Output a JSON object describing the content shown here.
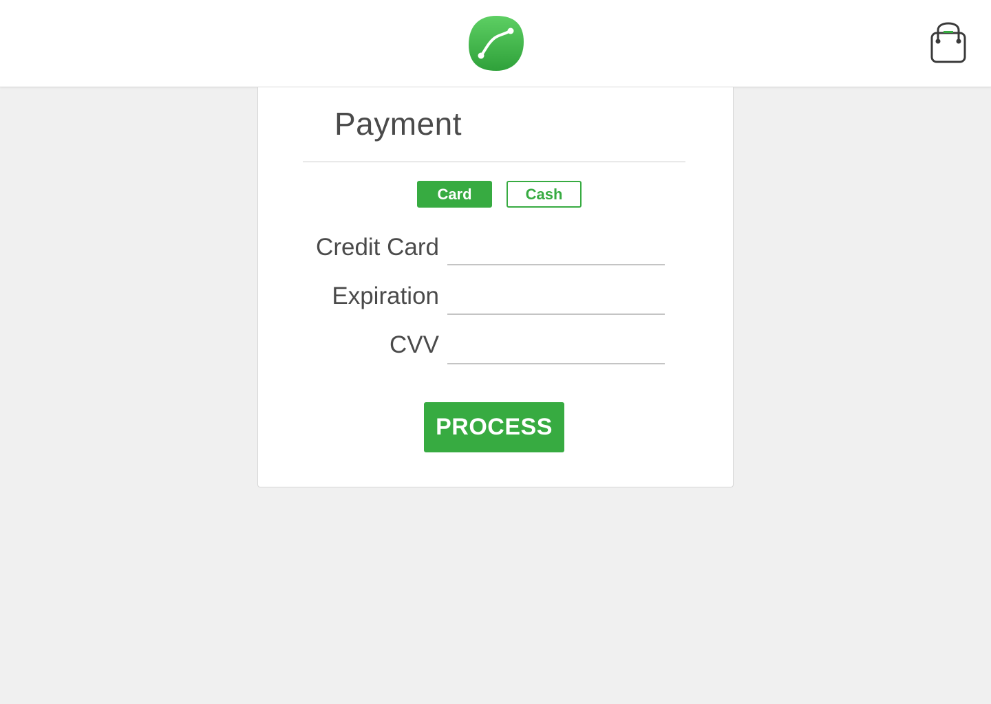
{
  "header": {
    "logo_icon": "app-logo-icon",
    "cart_icon": "shopping-bag-icon"
  },
  "payment": {
    "title": "Payment",
    "methods": [
      {
        "label": "Card",
        "selected": true
      },
      {
        "label": "Cash",
        "selected": false
      }
    ],
    "fields": [
      {
        "label": "Credit Card",
        "value": ""
      },
      {
        "label": "Expiration",
        "value": ""
      },
      {
        "label": "CVV",
        "value": ""
      }
    ],
    "submit_label": "PROCESS"
  },
  "colors": {
    "accent": "#37ab41",
    "background": "#f0f0f0",
    "text": "#4a4a4a"
  }
}
